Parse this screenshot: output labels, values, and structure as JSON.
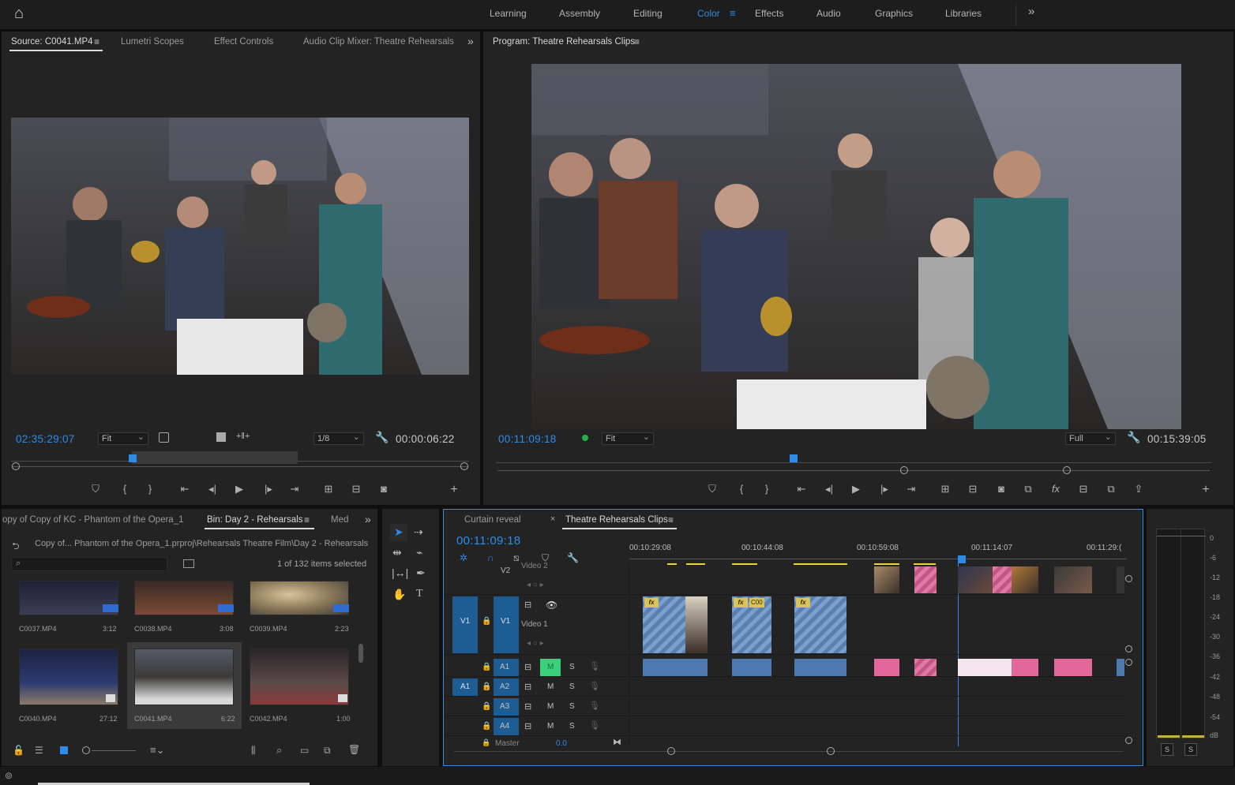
{
  "workspaces": {
    "home_label": "⌂",
    "tabs": [
      "Learning",
      "Assembly",
      "Editing",
      "Color",
      "Effects",
      "Audio",
      "Graphics",
      "Libraries"
    ],
    "active": "Color",
    "more": "»"
  },
  "source_panel": {
    "tabs": [
      "Source: C0041.MP4",
      "Lumetri Scopes",
      "Effect Controls",
      "Audio Clip Mixer: Theatre Rehearsals"
    ],
    "timecode": "02:35:29:07",
    "zoom": "Fit",
    "resolution": "1/8",
    "duration": "00:00:06:22"
  },
  "program_panel": {
    "title": "Program: Theatre Rehearsals Clips",
    "timecode": "00:11:09:18",
    "zoom": "Fit",
    "resolution": "Full",
    "duration": "00:15:39:05"
  },
  "project_panel": {
    "tabs": [
      "opy of Copy of KC - Phantom of the Opera_1",
      "Bin: Day 2 - Rehearsals",
      "Med"
    ],
    "path": "Copy of... Phantom of the Opera_1.prproj\\Rehearsals Theatre Film\\Day 2 - Rehearsals",
    "selection": "1 of 132 items selected",
    "clips": [
      {
        "name": "C0037.MP4",
        "dur": "3:12"
      },
      {
        "name": "C0038.MP4",
        "dur": "3:08"
      },
      {
        "name": "C0039.MP4",
        "dur": "2:23"
      },
      {
        "name": "C0040.MP4",
        "dur": "27:12"
      },
      {
        "name": "C0041.MP4",
        "dur": "6:22"
      },
      {
        "name": "C0042.MP4",
        "dur": "1:00"
      }
    ]
  },
  "timeline": {
    "tabs": [
      "Curtain reveal",
      "Theatre Rehearsals Clips"
    ],
    "timecode": "00:11:09:18",
    "ruler": [
      "00:10:29:08",
      "00:10:44:08",
      "00:10:59:08",
      "00:11:14:07",
      "00:11:29:("
    ],
    "tracks_video": [
      {
        "id": "V2",
        "name": "Video 2"
      },
      {
        "id": "V1",
        "name": "Video 1"
      }
    ],
    "tracks_audio": [
      {
        "id": "A1",
        "m": "M",
        "s": "S"
      },
      {
        "id": "A2",
        "m": "M",
        "s": "S"
      },
      {
        "id": "A3",
        "m": "M",
        "s": "S"
      },
      {
        "id": "A4",
        "m": "M",
        "s": "S"
      }
    ],
    "source_patch_v": "V1",
    "source_patch_a": "A1",
    "master_label": "Master",
    "master_value": "0.0",
    "clip_label": "C00",
    "fx_label": "fx"
  },
  "meter": {
    "labels": [
      "0",
      "-6",
      "-12",
      "-18",
      "-24",
      "-30",
      "-36",
      "-42",
      "-48",
      "-54",
      "dB"
    ],
    "solo": [
      "S",
      "S"
    ]
  },
  "colors": {
    "accent": "#2e8be8",
    "panel": "#232323",
    "video_clip": "#7aa0cc",
    "pink_clip": "#e07aa5"
  }
}
